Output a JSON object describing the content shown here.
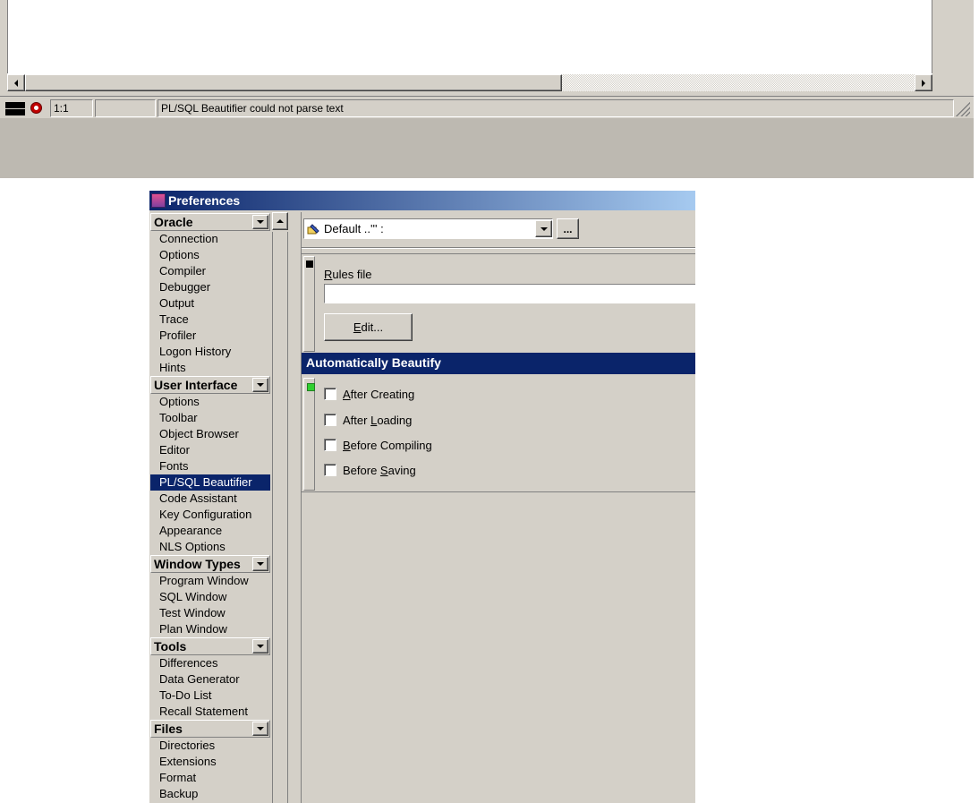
{
  "statusbar": {
    "position": "1:1",
    "message": "PL/SQL Beautifier could not parse text"
  },
  "dialog": {
    "title": "Preferences"
  },
  "nav": {
    "groups": [
      {
        "label": "Oracle",
        "items": [
          "Connection",
          "Options",
          "Compiler",
          "Debugger",
          "Output",
          "Trace",
          "Profiler",
          "Logon History",
          "Hints"
        ]
      },
      {
        "label": "User Interface",
        "items": [
          "Options",
          "Toolbar",
          "Object Browser",
          "Editor",
          "Fonts",
          "PL/SQL Beautifier",
          "Code Assistant",
          "Key Configuration",
          "Appearance",
          "NLS Options"
        ]
      },
      {
        "label": "Window Types",
        "items": [
          "Program Window",
          "SQL Window",
          "Test Window",
          "Plan Window"
        ]
      },
      {
        "label": "Tools",
        "items": [
          "Differences",
          "Data Generator",
          "To-Do List",
          "Recall Statement"
        ]
      },
      {
        "label": "Files",
        "items": [
          "Directories",
          "Extensions",
          "Format",
          "Backup"
        ]
      }
    ],
    "selected": "PL/SQL Beautifier"
  },
  "content": {
    "template_value": "Default ..'''      :",
    "more_label": "...",
    "rules_file_label_accel": "R",
    "rules_file_label_rest": "ules file",
    "rules_file_value": "",
    "edit_label_accel": "E",
    "edit_label_rest": "dit...",
    "auto_header": "Automatically Beautify",
    "checkboxes": [
      {
        "pre": "",
        "accel": "A",
        "post": "fter Creating",
        "checked": false
      },
      {
        "pre": "After ",
        "accel": "L",
        "post": "oading",
        "checked": false
      },
      {
        "pre": "",
        "accel": "B",
        "post": "efore Compiling",
        "checked": false
      },
      {
        "pre": "Before ",
        "accel": "S",
        "post": "aving",
        "checked": false
      }
    ]
  },
  "colors": {
    "face": "#d4d0c8",
    "selection": "#0a246a",
    "marker_green": "#30d030"
  }
}
